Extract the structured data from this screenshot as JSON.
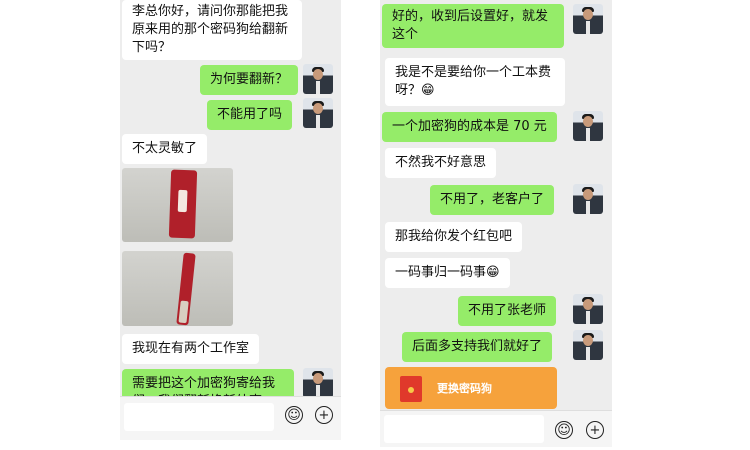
{
  "left_chat": {
    "messages": [
      {
        "text": "李总你好，请问你那能把我原来用的那个密码狗给翻新下吗？"
      },
      {
        "text": "为何要翻新？"
      },
      {
        "text": "不能用了吗"
      },
      {
        "text": "不太灵敏了"
      },
      {
        "text": "我现在有两个工作室"
      },
      {
        "text": "需要把这个加密狗寄给我们，我们翻新换新外壳"
      }
    ],
    "photos": [
      "usb-dongle-photo-front",
      "usb-dongle-photo-side"
    ]
  },
  "right_chat": {
    "messages": [
      {
        "text": "好的，收到后设置好，就发这个"
      },
      {
        "text": "我是不是要给你一个工本费呀？😁"
      },
      {
        "text": "一个加密狗的成本是 70 元"
      },
      {
        "text": "不然我不好意思"
      },
      {
        "text": "不用了，老客户了"
      },
      {
        "text": "那我给你发个红包吧"
      },
      {
        "text": "一码事归一码事😁"
      },
      {
        "text": "不用了张老师"
      },
      {
        "text": "后面多支持我们就好了"
      }
    ],
    "red_packet": {
      "label": "更换密码狗"
    }
  },
  "icons": {
    "emoji": "emoji-icon",
    "add": "plus-icon"
  },
  "colors": {
    "outgoing_bubble": "#95ec69",
    "incoming_bubble": "#ffffff",
    "chat_background": "#ededed",
    "red_packet": "#f6a23c"
  }
}
